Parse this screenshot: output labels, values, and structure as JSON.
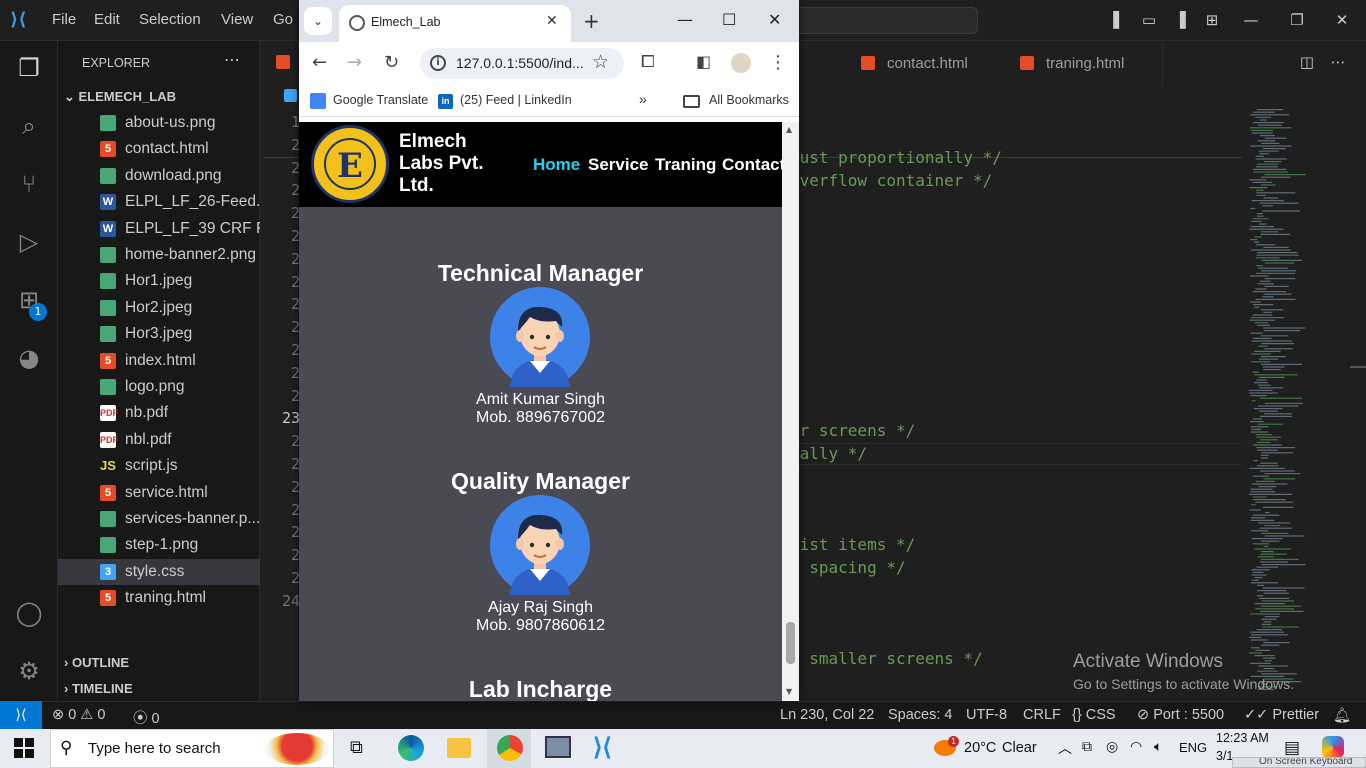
{
  "vscode": {
    "menu": [
      "File",
      "Edit",
      "Selection",
      "View",
      "Go"
    ],
    "explorer_title": "EXPLORER",
    "root_folder": "ELEMECH_LAB",
    "files": [
      {
        "name": "about-us.png",
        "type": "img"
      },
      {
        "name": "contact.html",
        "type": "html"
      },
      {
        "name": "download.png",
        "type": "img"
      },
      {
        "name": "ELPL_LF_26-Feed...",
        "type": "doc"
      },
      {
        "name": "ELPL_LF_39 CRF F...",
        "type": "doc"
      },
      {
        "name": "home-banner2.png",
        "type": "img"
      },
      {
        "name": "Hor1.jpeg",
        "type": "img"
      },
      {
        "name": "Hor2.jpeg",
        "type": "img"
      },
      {
        "name": "Hor3.jpeg",
        "type": "img"
      },
      {
        "name": "index.html",
        "type": "html"
      },
      {
        "name": "logo.png",
        "type": "img"
      },
      {
        "name": "nb.pdf",
        "type": "pdf"
      },
      {
        "name": "nbl.pdf",
        "type": "pdf"
      },
      {
        "name": "script.js",
        "type": "js"
      },
      {
        "name": "service.html",
        "type": "html"
      },
      {
        "name": "services-banner.p...",
        "type": "img"
      },
      {
        "name": "step-1.png",
        "type": "img"
      },
      {
        "name": "style.css",
        "type": "css",
        "selected": true
      },
      {
        "name": "traning.html",
        "type": "html"
      }
    ],
    "outline": "OUTLINE",
    "timeline": "TIMELINE",
    "extensions_badge": "1",
    "tabs": [
      "contact.html",
      "traning.html"
    ],
    "line_numbers": [
      "1",
      "2",
      "2",
      "2",
      "2",
      "2",
      "2",
      "2",
      "2",
      "2",
      "2",
      "2",
      "2",
      "23",
      "2",
      "2",
      "2",
      "2",
      "2",
      "2",
      "2",
      "24"
    ],
    "code_comments": [
      "just proportionally */",
      " overflow container */",
      "er screens */",
      "tally */",
      " list items */",
      "r spacing */",
      "r smaller screens */"
    ],
    "watermark_title": "Activate Windows",
    "watermark_sub": "Go to Settings to activate Windows.",
    "status": {
      "errors": "0",
      "warnings": "0",
      "ports": "0",
      "position": "Ln 230, Col 22",
      "spaces": "Spaces: 4",
      "encoding": "UTF-8",
      "eol": "CRLF",
      "language": "CSS",
      "port": "Port : 5500",
      "prettier": "Prettier"
    }
  },
  "chrome": {
    "tab_title": "Elmech_Lab",
    "url": "127.0.0.1:5500/ind...",
    "bookmarks": [
      "Google Translate",
      "(25) Feed | LinkedIn",
      "All Bookmarks"
    ]
  },
  "site": {
    "name": "Elmech Labs Pvt. Ltd.",
    "logo_text": "ELMECH LABS",
    "nav": [
      "Home",
      "Service",
      "Traning",
      "Contact"
    ],
    "active_nav": "Home",
    "people": [
      {
        "role": "Technical Manager",
        "name": "Amit Kumar Singh",
        "mobile": "Mob. 8896767002"
      },
      {
        "role": "Quality Manager",
        "name": "Ajay Raj Singh",
        "mobile": "Mob. 9807860612"
      },
      {
        "role": "Lab Incharge"
      }
    ]
  },
  "taskbar": {
    "search_placeholder": "Type here to search",
    "weather_badge": "1",
    "temperature": "20°C",
    "weather": "Clear",
    "language": "ENG",
    "time": "12:23 AM",
    "date": "3/1",
    "notification_preview": "On Screen Keyboard"
  },
  "colors": {
    "vscode_bg": "#1f1f1f",
    "accent": "#0078d4",
    "comment_green": "#6a9955",
    "site_active_link": "#1ed1f0",
    "site_bg": "#494a54"
  }
}
